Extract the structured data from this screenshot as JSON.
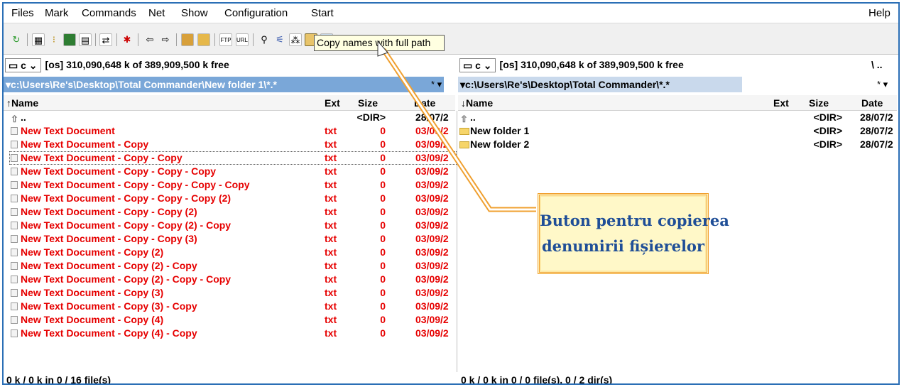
{
  "menu": {
    "files": "Files",
    "mark": "Mark",
    "commands": "Commands",
    "net": "Net",
    "show": "Show",
    "configuration": "Configuration",
    "start": "Start",
    "help": "Help"
  },
  "tooltip": "Copy names with full path",
  "left": {
    "drive": "c",
    "free": "[os]  310,090,648 k of 389,909,500 k free",
    "path": "c:\\Users\\Re's\\Desktop\\Total Commander\\New folder 1\\*.*",
    "path_end": "* ▾",
    "cols": {
      "name": "Name",
      "ext": "Ext",
      "size": "Size",
      "date": "Date"
    },
    "up": {
      "name": "..",
      "size": "<DIR>",
      "date": "28/07/2"
    },
    "files": [
      {
        "name": "New Text Document",
        "ext": "txt",
        "size": "0",
        "date": "03/09/2"
      },
      {
        "name": "New Text Document - Copy",
        "ext": "txt",
        "size": "0",
        "date": "03/09/2"
      },
      {
        "name": "New Text Document - Copy - Copy",
        "ext": "txt",
        "size": "0",
        "date": "03/09/2"
      },
      {
        "name": "New Text Document - Copy - Copy - Copy",
        "ext": "txt",
        "size": "0",
        "date": "03/09/2"
      },
      {
        "name": "New Text Document - Copy - Copy - Copy - Copy",
        "ext": "txt",
        "size": "0",
        "date": "03/09/2"
      },
      {
        "name": "New Text Document - Copy - Copy - Copy (2)",
        "ext": "txt",
        "size": "0",
        "date": "03/09/2"
      },
      {
        "name": "New Text Document - Copy - Copy (2)",
        "ext": "txt",
        "size": "0",
        "date": "03/09/2"
      },
      {
        "name": "New Text Document - Copy - Copy (2) - Copy",
        "ext": "txt",
        "size": "0",
        "date": "03/09/2"
      },
      {
        "name": "New Text Document - Copy - Copy (3)",
        "ext": "txt",
        "size": "0",
        "date": "03/09/2"
      },
      {
        "name": "New Text Document - Copy (2)",
        "ext": "txt",
        "size": "0",
        "date": "03/09/2"
      },
      {
        "name": "New Text Document - Copy (2) - Copy",
        "ext": "txt",
        "size": "0",
        "date": "03/09/2"
      },
      {
        "name": "New Text Document - Copy (2) - Copy - Copy",
        "ext": "txt",
        "size": "0",
        "date": "03/09/2"
      },
      {
        "name": "New Text Document - Copy (3)",
        "ext": "txt",
        "size": "0",
        "date": "03/09/2"
      },
      {
        "name": "New Text Document - Copy (3) - Copy",
        "ext": "txt",
        "size": "0",
        "date": "03/09/2"
      },
      {
        "name": "New Text Document - Copy (4)",
        "ext": "txt",
        "size": "0",
        "date": "03/09/2"
      },
      {
        "name": "New Text Document - Copy (4) - Copy",
        "ext": "txt",
        "size": "0",
        "date": "03/09/2"
      }
    ],
    "status": "0 k / 0 k in 0 / 16 file(s)"
  },
  "right": {
    "drive": "c",
    "free": "[os]  310,090,648 k of 389,909,500 k free",
    "path": "c:\\Users\\Re's\\Desktop\\Total Commander\\*.*",
    "path_end": "* ▾",
    "root_btn": "\\ ..",
    "cols": {
      "name": "Name",
      "ext": "Ext",
      "size": "Size",
      "date": "Date"
    },
    "up": {
      "name": "..",
      "size": "<DIR>",
      "date": "28/07/2"
    },
    "dirs": [
      {
        "name": "New folder 1",
        "size": "<DIR>",
        "date": "28/07/2"
      },
      {
        "name": "New folder 2",
        "size": "<DIR>",
        "date": "28/07/2"
      }
    ],
    "status": "0 k / 0 k in 0 / 0 file(s), 0 / 2 dir(s)"
  },
  "annotation": {
    "line1": "Buton pentru copierea",
    "line2": "denumirii fișierelor"
  },
  "colors": {
    "file_red": "#e60000",
    "path_active": "#7aa7d8",
    "frame": "#2b6fb6",
    "callout_text": "#1f4e97",
    "callout_bg": "#fff8c8"
  }
}
